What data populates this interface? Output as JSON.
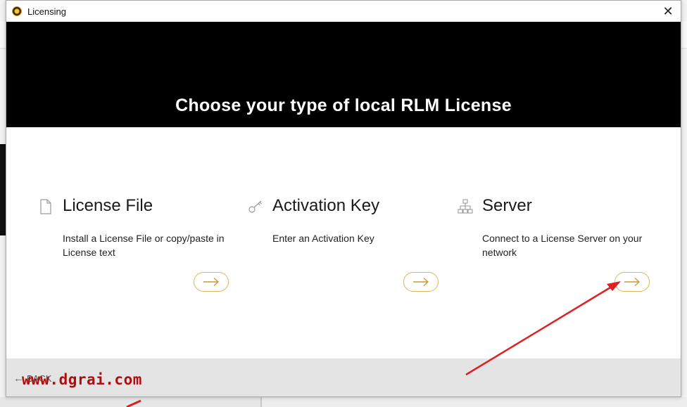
{
  "window": {
    "title": "Licensing",
    "close_glyph": "✕"
  },
  "banner": {
    "title": "Choose your type of local RLM License"
  },
  "options": [
    {
      "title": "License File",
      "description": "Install a License File or copy/paste in License text",
      "icon": "document-icon"
    },
    {
      "title": "Activation Key",
      "description": "Enter an Activation Key",
      "icon": "key-icon"
    },
    {
      "title": "Server",
      "description": "Connect to a License Server on your network",
      "icon": "network-icon"
    }
  ],
  "footer": {
    "back_label": "BACK"
  },
  "watermark": "www.dgrai.com",
  "colors": {
    "accent_button_border": "#e0b45c",
    "annotation_arrow": "#e02020",
    "watermark": "#b00e0e"
  }
}
